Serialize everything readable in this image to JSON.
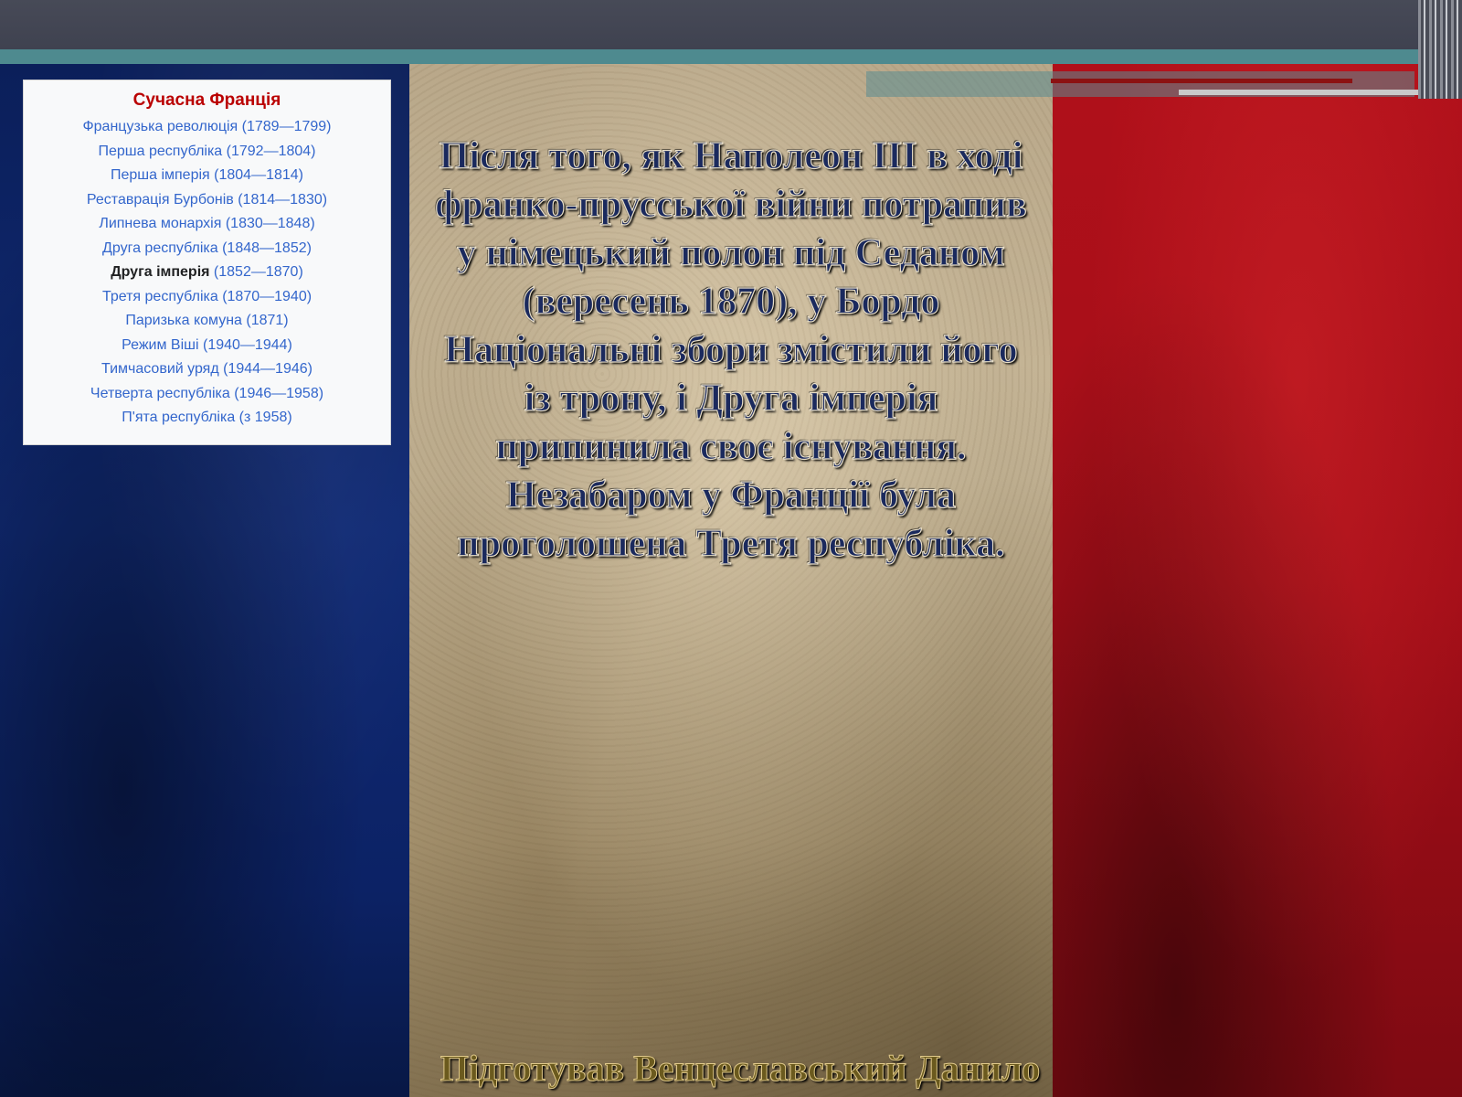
{
  "infobox": {
    "title": "Сучасна Франція",
    "items": [
      {
        "name": "Французька революція",
        "years": "(1789—1799)"
      },
      {
        "name": "Перша республіка",
        "years": "(1792—1804)"
      },
      {
        "name": "Перша імперія",
        "years": "(1804—1814)"
      },
      {
        "name": "Реставрація Бурбонів",
        "years": "(1814—1830)"
      },
      {
        "name": "Липнева монархія",
        "years": "(1830—1848)"
      },
      {
        "name": "Друга республіка",
        "years": "(1848—1852)"
      },
      {
        "name": "Друга імперія",
        "years": "(1852—1870)"
      },
      {
        "name": "Третя республіка",
        "years": "(1870—1940)"
      },
      {
        "name": "Паризька комуна",
        "years": "(1871)"
      },
      {
        "name": "Режим Віші",
        "years": "(1940—1944)"
      },
      {
        "name": "Тимчасовий уряд",
        "years": "(1944—1946)"
      },
      {
        "name": "Четверта республіка",
        "years": "(1946—1958)"
      },
      {
        "name": "П'ята республіка",
        "years": "(з 1958)"
      }
    ],
    "current_index": 6
  },
  "main_text": "Після того, як Наполеон III в ході франко-прусської війни потрапив у німецький полон під Седаном (вересень 1870), у Бордо Національні збори змістили його із трону, і Друга імперія припинила своє існування. Незабаром у Франції була проголошена Третя республіка.",
  "credit": "Підготував Венцеславський Данило",
  "colors": {
    "flag_blue": "#102a74",
    "flag_white": "#c8b899",
    "flag_red": "#a40e18",
    "header": "#474a57",
    "teal": "#4e8a8f",
    "infobox_title": "#ba0000",
    "link": "#3366cc"
  }
}
